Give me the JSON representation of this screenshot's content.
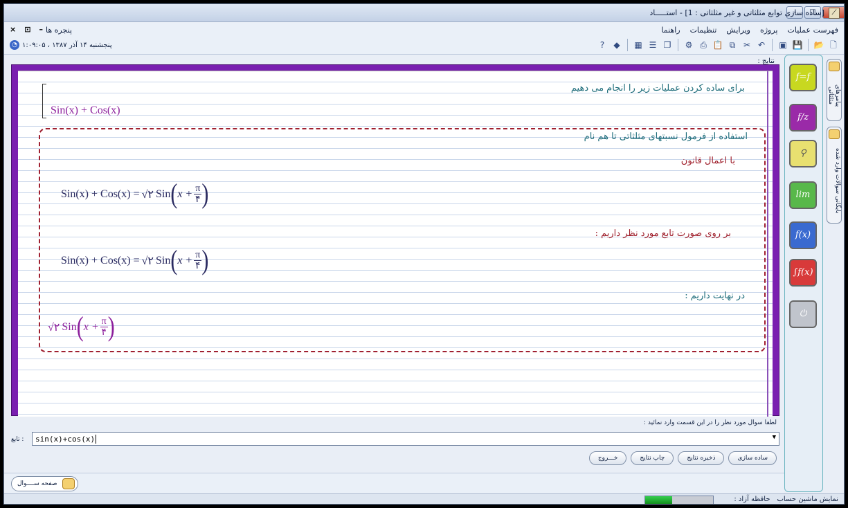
{
  "window": {
    "title": "[ساده سازی توابع مثلثاتی و غیر مثلثاتی : 1] - استـــــاد",
    "controls": {
      "minimize": "–",
      "maximize": "□",
      "close": "✕"
    }
  },
  "menubar": {
    "mdi_close": "×",
    "mdi_restore": "⊡",
    "mdi_min": "–",
    "windows_label": "پنجره ها",
    "items": [
      "فهرست عملیات",
      "پروژه",
      "ویرایش",
      "تنظیمات",
      "راهنما"
    ]
  },
  "toolbar": {
    "datetime": "۱:۰۹:۰۵ ، پنجشنبه ۱۴ آذر ۱۳۸۷",
    "clock_icon": "◔"
  },
  "results": {
    "label": "نتایج :",
    "intro": "برای ساده کردن عملیات زیر را انجام می دهیم",
    "input_expr": "Sin(x) + Cos(x)",
    "step1": "استفاده از فرمول نسبتهای مثلثاتی تا هم نام",
    "step1b": "با اعمال قانون",
    "step2": "بر روی صورت تابع مورد نظر داریم :",
    "final_label": "در نهایت داریم :",
    "lhs": "Sin(x) + Cos(x) =",
    "sqrt_two": "√۲",
    "sin": "Sin",
    "x_plus": "x +",
    "pi": "π",
    "four": "۴"
  },
  "input": {
    "prompt": "لطفا سوال مورد نظر را در این قسمت وارد نمائید :",
    "field_label": ": تابع",
    "value": "sin(x)+cos(x)",
    "arrow": "▼"
  },
  "buttons": {
    "simplify": "ساده سازی",
    "save": "ذخیره نتایج",
    "print": "چاپ نتایج",
    "exit": "خـــروج"
  },
  "page_tab": {
    "label": "صفحه ســــوال"
  },
  "status": {
    "calc": "نمایش ماشین حساب",
    "memory": "حافظه آزاد :",
    "memory_fill": 0.4
  },
  "sidebar_tools": [
    {
      "label": "f=f",
      "color": "#c8d820"
    },
    {
      "label": "f/z",
      "color": "#9a2aa8"
    },
    {
      "label": "⚲",
      "color": "#e8e070"
    },
    {
      "label": "lim",
      "color": "#58b84a"
    },
    {
      "label": "f(x)",
      "color": "#3a6ad0"
    },
    {
      "label": "∫f(x)",
      "color": "#d83a3a"
    },
    {
      "label": "⏻",
      "color": "#c0c4cc"
    }
  ],
  "vertical_tabs": {
    "tab1": "پیامرهای مثلثاتی",
    "tab2": "بایگانی سوالات وارد شده"
  }
}
